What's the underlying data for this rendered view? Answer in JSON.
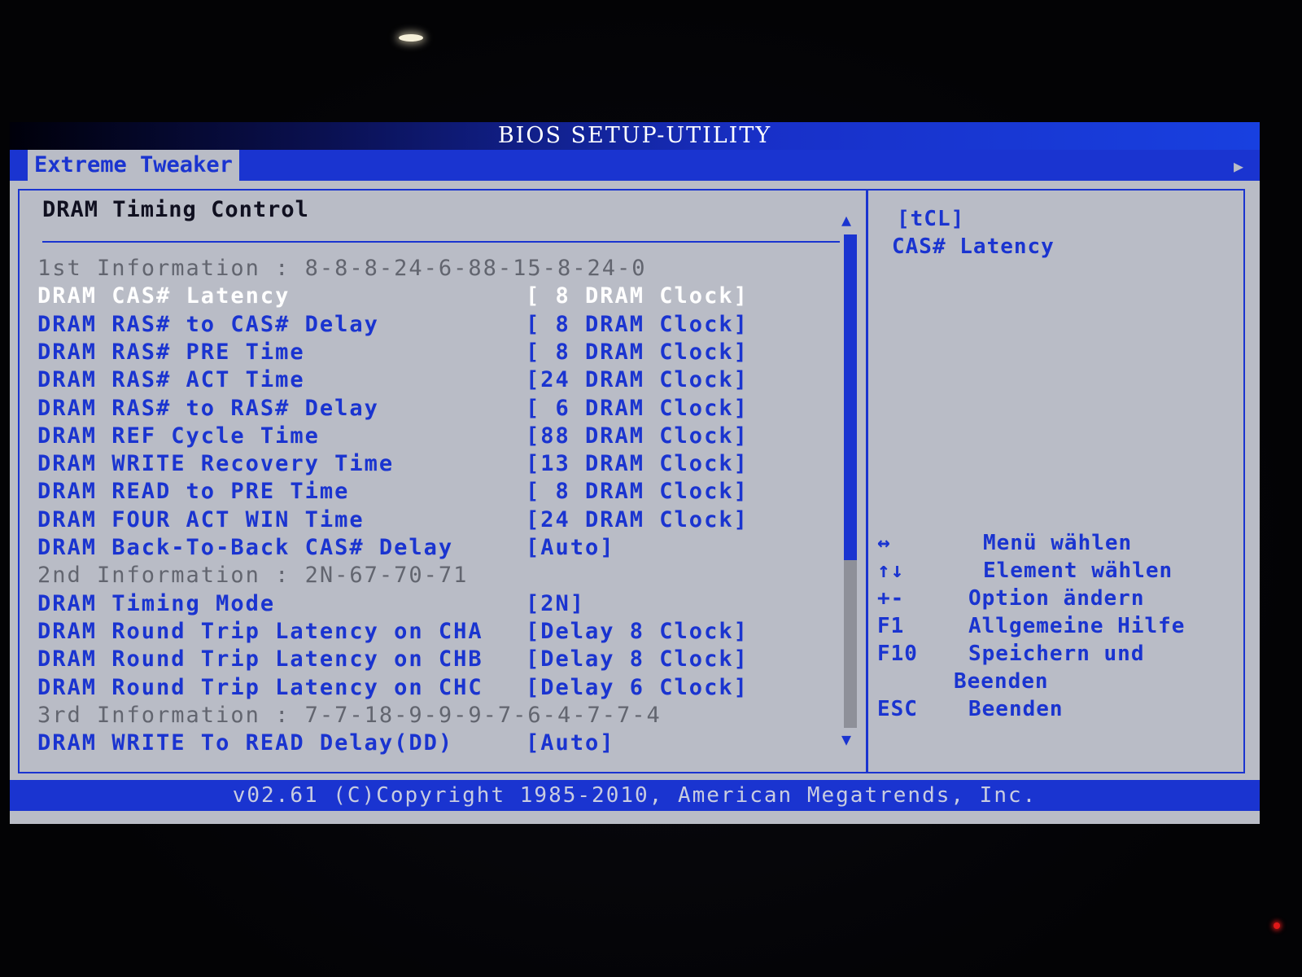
{
  "title": "BIOS SETUP-UTILITY",
  "active_tab": "Extreme Tweaker",
  "section_title": "DRAM Timing Control",
  "rows": [
    {
      "kind": "info",
      "label": "1st Information : 8-8-8-24-6-88-15-8-24-0",
      "value": ""
    },
    {
      "kind": "selected",
      "label": "DRAM CAS# Latency",
      "value": "[ 8 DRAM Clock]"
    },
    {
      "kind": "setting",
      "label": "DRAM RAS# to CAS# Delay",
      "value": "[ 8 DRAM Clock]"
    },
    {
      "kind": "setting",
      "label": "DRAM RAS# PRE Time",
      "value": "[ 8 DRAM Clock]"
    },
    {
      "kind": "setting",
      "label": "DRAM RAS# ACT Time",
      "value": "[24 DRAM Clock]"
    },
    {
      "kind": "setting",
      "label": "DRAM RAS# to RAS# Delay",
      "value": "[ 6 DRAM Clock]"
    },
    {
      "kind": "setting",
      "label": "DRAM REF Cycle Time",
      "value": "[88 DRAM Clock]"
    },
    {
      "kind": "setting",
      "label": "DRAM WRITE Recovery Time",
      "value": "[13 DRAM Clock]"
    },
    {
      "kind": "setting",
      "label": "DRAM READ to PRE Time",
      "value": "[ 8 DRAM Clock]"
    },
    {
      "kind": "setting",
      "label": "DRAM FOUR ACT WIN Time",
      "value": "[24 DRAM Clock]"
    },
    {
      "kind": "setting",
      "label": "DRAM Back-To-Back CAS# Delay",
      "value": "[Auto]"
    },
    {
      "kind": "info",
      "label": "2nd Information : 2N-67-70-71",
      "value": ""
    },
    {
      "kind": "setting",
      "label": "DRAM Timing Mode",
      "value": "[2N]"
    },
    {
      "kind": "setting",
      "label": "DRAM Round Trip Latency on CHA",
      "value": "[Delay 8 Clock]"
    },
    {
      "kind": "setting",
      "label": "DRAM Round Trip Latency on CHB",
      "value": "[Delay 8 Clock]"
    },
    {
      "kind": "setting",
      "label": "DRAM Round Trip Latency on CHC",
      "value": "[Delay 6 Clock]"
    },
    {
      "kind": "info",
      "label": "3rd Information : 7-7-18-9-9-9-7-6-4-7-7-4",
      "value": ""
    },
    {
      "kind": "setting",
      "label": "DRAM WRITE To READ Delay(DD)",
      "value": "[Auto]"
    }
  ],
  "help": {
    "tag": "[tCL]",
    "title": "CAS# Latency"
  },
  "keys": [
    {
      "key": "↔",
      "desc": "Menü wählen"
    },
    {
      "key": "↑↓",
      "desc": "Element wählen"
    },
    {
      "key": "+-",
      "desc": "Option ändern"
    },
    {
      "key": "F1",
      "desc": "Allgemeine Hilfe"
    },
    {
      "key": "F10",
      "desc": "Speichern und"
    },
    {
      "key": "",
      "desc": "Beenden"
    },
    {
      "key": "ESC",
      "desc": "Beenden"
    }
  ],
  "footer": "v02.61 (C)Copyright 1985-2010, American Megatrends, Inc.",
  "colors": {
    "bios_blue": "#1a34d0",
    "panel_gray": "#b9bcc6",
    "selected_text": "#ffffff",
    "info_text": "#62656f"
  }
}
